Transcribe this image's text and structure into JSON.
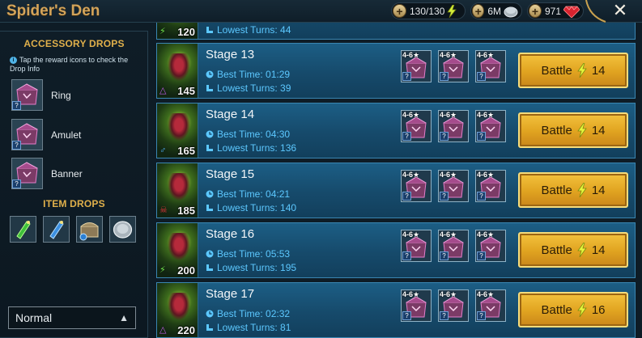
{
  "header": {
    "title": "Spider's Den",
    "resources": [
      {
        "name": "energy",
        "value": "130/130",
        "icon": "lightning-icon"
      },
      {
        "name": "silver",
        "value": "6M",
        "icon": "silver-coin-icon"
      },
      {
        "name": "gems",
        "value": "971",
        "icon": "ruby-gem-icon"
      }
    ],
    "close_icon": "close-icon"
  },
  "sidebar": {
    "accessory_heading": "ACCESSORY DROPS",
    "info_text": "Tap the reward icons to check the Drop Info",
    "accessories": [
      {
        "label": "Ring"
      },
      {
        "label": "Amulet"
      },
      {
        "label": "Banner"
      }
    ],
    "item_heading": "ITEM DROPS",
    "items": [
      {
        "icon": "green-potion-icon"
      },
      {
        "icon": "blue-potion-icon"
      },
      {
        "icon": "chest-icon"
      },
      {
        "icon": "silver-coin-icon"
      }
    ],
    "difficulty": {
      "selected": "Normal"
    },
    "question_mark": "?"
  },
  "stages": {
    "partial": {
      "level": "120",
      "lowest_turns": "Lowest Turns: 44"
    },
    "rows": [
      {
        "name": "Stage 13",
        "level": "145",
        "affinity": "magic",
        "best_time": "Best Time: 01:29",
        "lowest_turns": "Lowest Turns: 39",
        "battle_label": "Battle",
        "energy": "14"
      },
      {
        "name": "Stage 14",
        "level": "165",
        "affinity": "void",
        "best_time": "Best Time: 04:30",
        "lowest_turns": "Lowest Turns: 136",
        "battle_label": "Battle",
        "energy": "14"
      },
      {
        "name": "Stage 15",
        "level": "185",
        "affinity": "force",
        "best_time": "Best Time: 04:21",
        "lowest_turns": "Lowest Turns: 140",
        "battle_label": "Battle",
        "energy": "14"
      },
      {
        "name": "Stage 16",
        "level": "200",
        "affinity": "spirit",
        "best_time": "Best Time: 05:53",
        "lowest_turns": "Lowest Turns: 195",
        "battle_label": "Battle",
        "energy": "14"
      },
      {
        "name": "Stage 17",
        "level": "220",
        "affinity": "magic",
        "best_time": "Best Time: 02:32",
        "lowest_turns": "Lowest Turns: 81",
        "battle_label": "Battle",
        "energy": "16"
      }
    ],
    "reward_rank": "4-6★",
    "reward_question": "?"
  }
}
